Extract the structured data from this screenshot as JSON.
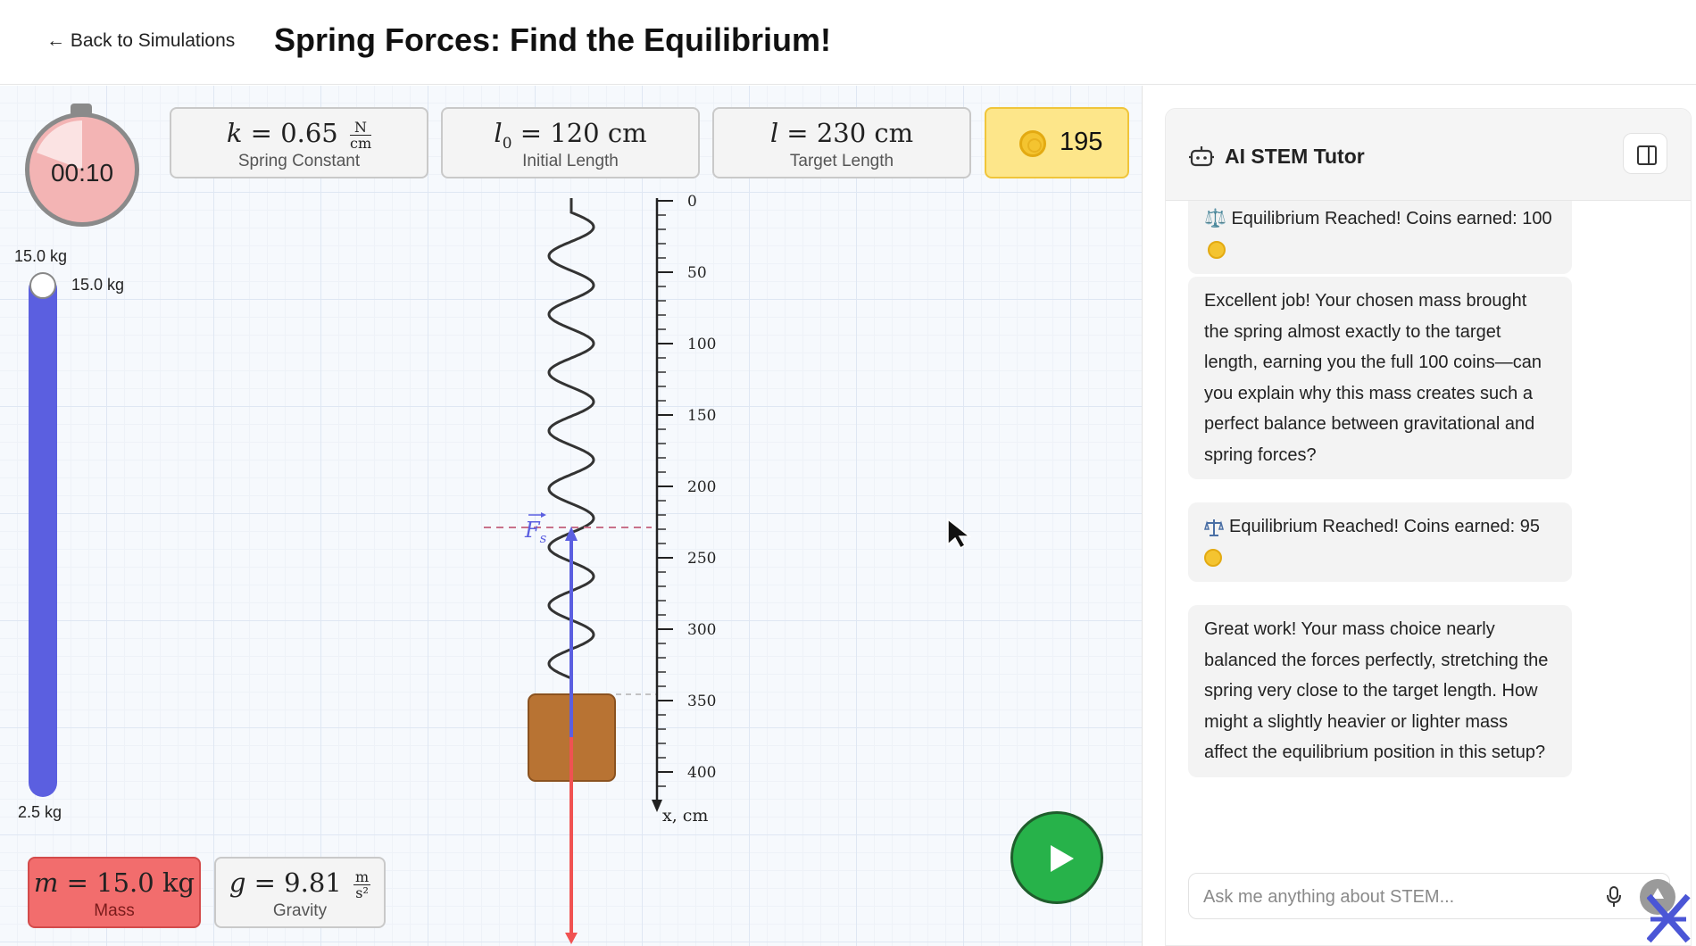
{
  "header": {
    "back_label": "← Back to Simulations",
    "title": "Spring Forces: Find the Equilibrium!"
  },
  "params": {
    "spring_constant": {
      "symbol": "k",
      "value": "0.65",
      "unit_num": "N",
      "unit_den": "cm",
      "label": "Spring Constant"
    },
    "initial_length": {
      "symbol": "l",
      "sub": "0",
      "value": "120",
      "unit": "cm",
      "label": "Initial Length"
    },
    "target_length": {
      "symbol": "l",
      "value": "230",
      "unit": "cm",
      "label": "Target Length"
    },
    "coins": "195"
  },
  "timer": {
    "display": "00:10"
  },
  "mass_slider": {
    "max_label": "15.0 kg",
    "value_label": "15.0 kg",
    "min_label": "2.5 kg",
    "fraction": 1.0
  },
  "bottom_params": {
    "mass": {
      "symbol": "m",
      "value": "15.0",
      "unit": "kg",
      "label": "Mass"
    },
    "gravity": {
      "symbol": "g",
      "value": "9.81",
      "unit_num": "m",
      "unit_den": "s²",
      "label": "Gravity"
    }
  },
  "ruler": {
    "ticks": [
      "0",
      "50",
      "100",
      "150",
      "200",
      "250",
      "300",
      "350",
      "400"
    ],
    "axis_label": "x, cm",
    "force_label": "F",
    "force_sub": "s"
  },
  "colors": {
    "slider": "#5b5fe0",
    "mass_card": "#f26d6d",
    "coins_card": "#fde68a",
    "play": "#27b24a",
    "block": "#b87333",
    "spring_force": "#5b5fe0",
    "gravity_force": "#f05252"
  },
  "tutor": {
    "title": "AI STEM Tutor",
    "messages": [
      {
        "text": "⚖️ Equilibrium Reached! Coins earned: 100"
      },
      {
        "text": "Excellent job! Your chosen mass brought the spring almost exactly to the target length, earning you the full 100 coins—can you explain why this mass creates such a perfect balance between gravitational and spring forces?"
      },
      {
        "text": "Equilibrium Reached! Coins earned: 95"
      },
      {
        "text": "Great work! Your mass choice nearly balanced the forces perfectly, stretching the spring very close to the target length. How might a slightly heavier or lighter mass affect the equilibrium position in this setup?"
      }
    ],
    "input_placeholder": "Ask me anything about STEM..."
  },
  "icons": {
    "robot": "robot-icon",
    "panel": "panel-toggle-icon",
    "mic": "microphone-icon",
    "send": "send-arrow-icon",
    "coin": "coin-icon",
    "scale": "balance-scale-icon",
    "play": "play-icon"
  }
}
